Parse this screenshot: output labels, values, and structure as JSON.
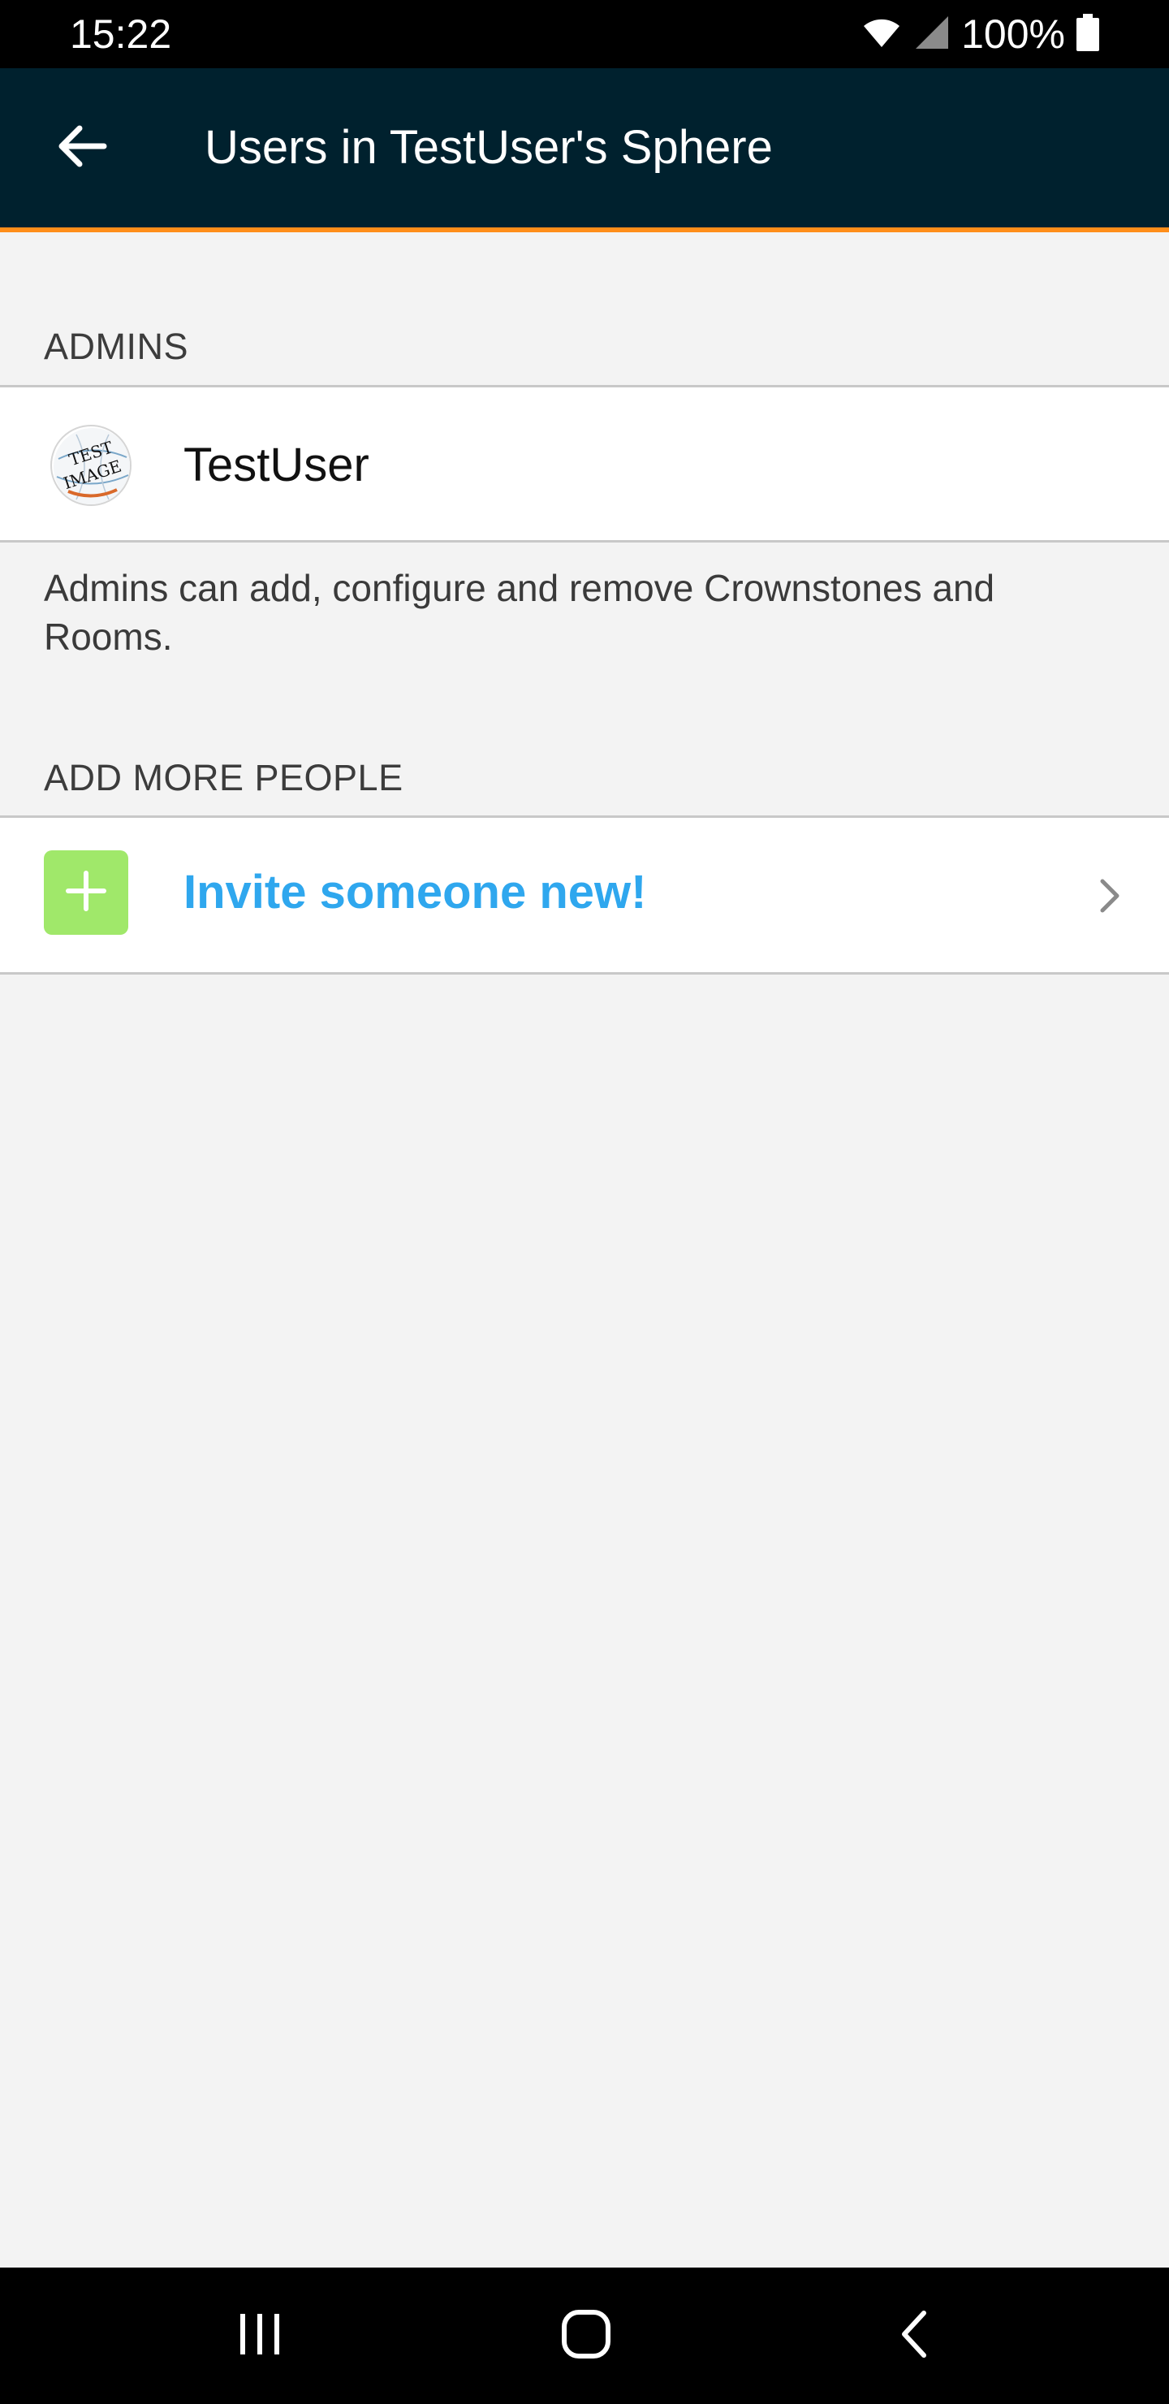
{
  "status_bar": {
    "time": "15:22",
    "battery_percent": "100%",
    "icons": [
      "wifi-icon",
      "cell-signal-icon",
      "battery-icon"
    ]
  },
  "app_bar": {
    "title": "Users in TestUser's Sphere",
    "back_icon": "arrow-left-icon",
    "background_color": "#00212e",
    "accent_color": "#ff8e1a"
  },
  "admins_section": {
    "header": "ADMINS",
    "users": [
      {
        "name": "TestUser",
        "avatar_icon": "test-image-avatar"
      }
    ],
    "description": "Admins can add, configure and remove Crownstones and Rooms."
  },
  "add_people_section": {
    "header": "ADD MORE PEOPLE",
    "invite_label": "Invite someone new!",
    "invite_icon": "plus-icon",
    "invite_color": "#2fa7ee",
    "tile_color": "#a0e86a"
  },
  "nav_bar": {
    "buttons": [
      "recent-apps-icon",
      "home-icon",
      "back-icon"
    ]
  }
}
